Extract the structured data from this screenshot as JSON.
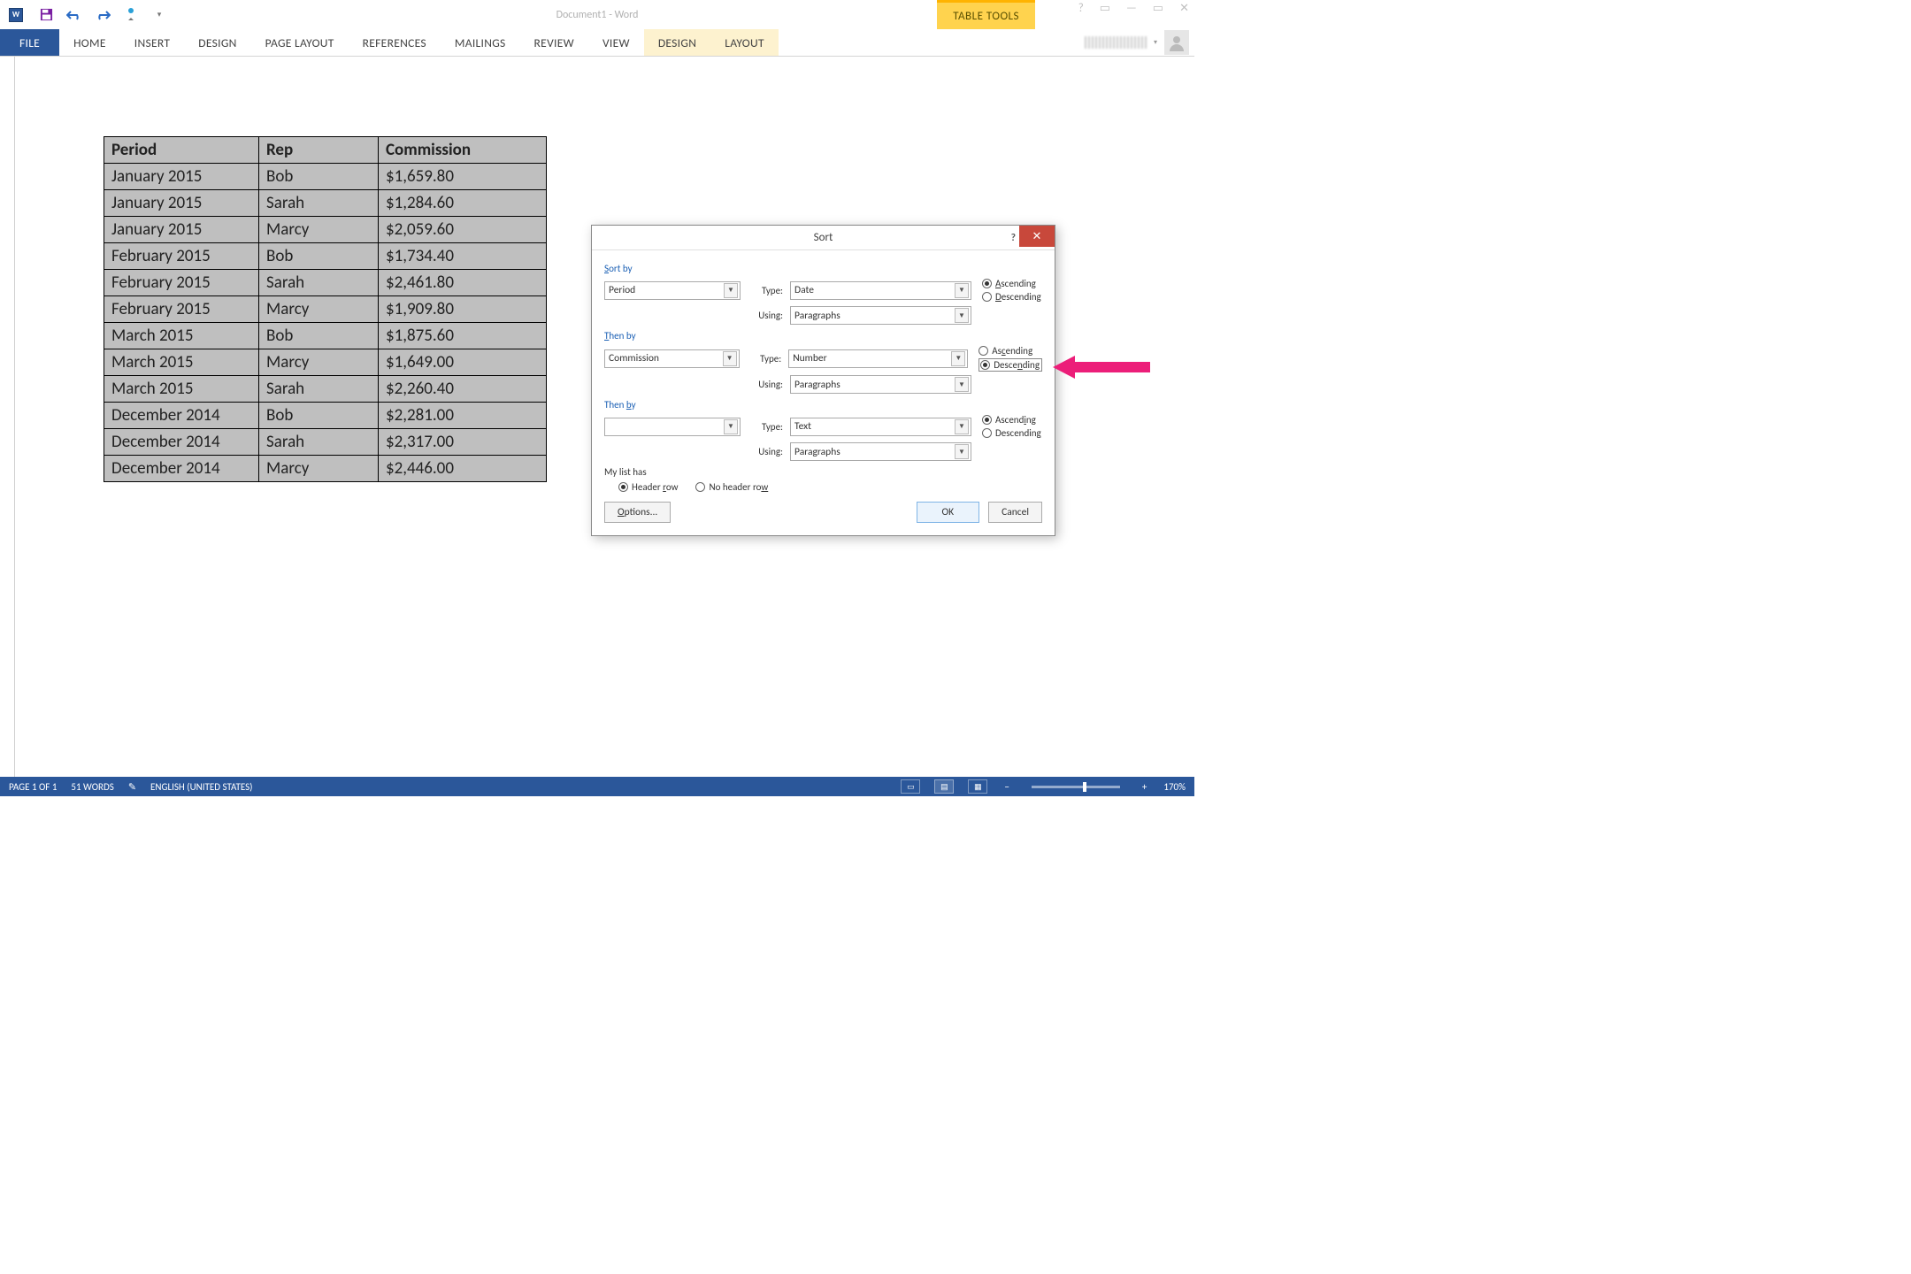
{
  "title": "Document1 - Word",
  "context_tab": "TABLE TOOLS",
  "ribbon": {
    "file": "FILE",
    "tabs": [
      "HOME",
      "INSERT",
      "DESIGN",
      "PAGE LAYOUT",
      "REFERENCES",
      "MAILINGS",
      "REVIEW",
      "VIEW"
    ],
    "context_tabs": [
      "DESIGN",
      "LAYOUT"
    ]
  },
  "table": {
    "headers": [
      "Period",
      "Rep",
      "Commission"
    ],
    "rows": [
      [
        "January 2015",
        "Bob",
        "$1,659.80"
      ],
      [
        "January 2015",
        "Sarah",
        "$1,284.60"
      ],
      [
        "January 2015",
        "Marcy",
        "$2,059.60"
      ],
      [
        "February 2015",
        "Bob",
        "$1,734.40"
      ],
      [
        "February 2015",
        "Sarah",
        "$2,461.80"
      ],
      [
        "February 2015",
        "Marcy",
        "$1,909.80"
      ],
      [
        "March 2015",
        "Bob",
        "$1,875.60"
      ],
      [
        "March 2015",
        "Marcy",
        "$1,649.00"
      ],
      [
        "March 2015",
        "Sarah",
        "$2,260.40"
      ],
      [
        "December 2014",
        "Bob",
        "$2,281.00"
      ],
      [
        "December 2014",
        "Sarah",
        "$2,317.00"
      ],
      [
        "December 2014",
        "Marcy",
        "$2,446.00"
      ]
    ]
  },
  "dialog": {
    "title": "Sort",
    "sort_by_label": "Sort by",
    "then_by_label": "Then by",
    "type_label": "Type:",
    "using_label": "Using:",
    "ascending": "Ascending",
    "descending": "Descending",
    "level1": {
      "field": "Period",
      "type": "Date",
      "using": "Paragraphs",
      "order": "asc"
    },
    "level2": {
      "field": "Commission",
      "type": "Number",
      "using": "Paragraphs",
      "order": "desc"
    },
    "level3": {
      "field": "",
      "type": "Text",
      "using": "Paragraphs",
      "order": "asc"
    },
    "list_has_label": "My list has",
    "header_row": "Header row",
    "no_header_row": "No header row",
    "header_row_selected": true,
    "options_btn": "Options...",
    "ok_btn": "OK",
    "cancel_btn": "Cancel"
  },
  "status": {
    "page": "PAGE 1 OF 1",
    "words": "51 WORDS",
    "lang": "ENGLISH (UNITED STATES)",
    "zoom": "170%"
  }
}
